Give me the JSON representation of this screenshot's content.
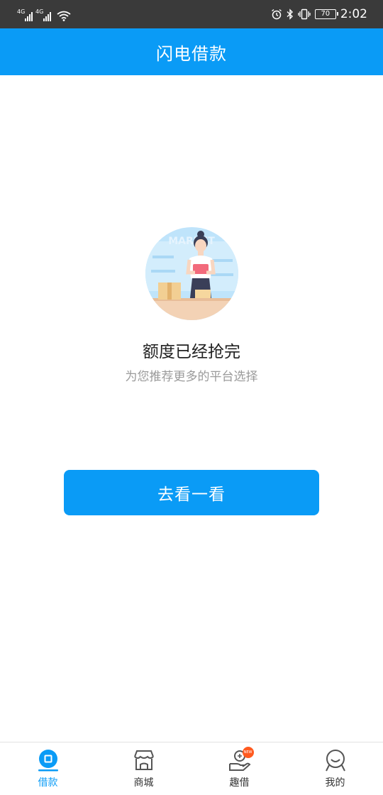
{
  "status_bar": {
    "network_1": "4G",
    "network_2": "4G",
    "battery_level": "70",
    "time": "2:02"
  },
  "header": {
    "title": "闪电借款"
  },
  "empty_state": {
    "illustration_text": "MARKET",
    "headline": "额度已经抢完",
    "subline": "为您推荐更多的平台选择",
    "button_label": "去看一看"
  },
  "bottom_nav": {
    "items": [
      {
        "label": "借款",
        "icon": "loan-icon",
        "active": true
      },
      {
        "label": "商城",
        "icon": "store-icon",
        "active": false
      },
      {
        "label": "趣借",
        "icon": "hand-coin-icon",
        "active": false,
        "badge": "NEW"
      },
      {
        "label": "我的",
        "icon": "profile-icon",
        "active": false
      }
    ]
  },
  "colors": {
    "primary": "#0a9bf6",
    "status_bar": "#3a3a3a",
    "badge": "#ff5a1f"
  }
}
